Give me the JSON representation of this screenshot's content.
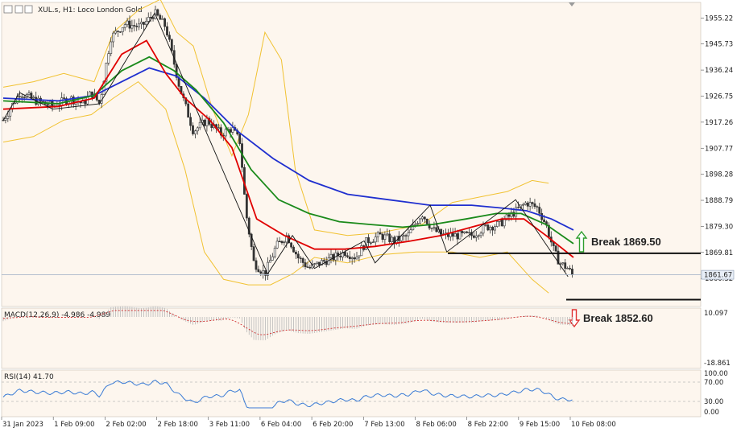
{
  "header": {
    "symbol": "XUL.s",
    "timeframe": "H1",
    "instrument": "Loco London Gold",
    "title": "XUL.s, H1:  Loco London Gold"
  },
  "colors": {
    "background": "#fdf6ee",
    "candle": "#333333",
    "bollinger": "#f1c232",
    "ma_fast": "#e00000",
    "ma_mid": "#1a8a1a",
    "ma_slow": "#1f2fcf",
    "zigzag": "#111111",
    "macd_hist": "#b8b8b8",
    "macd_signal": "#d03030",
    "rsi": "#3a7bd5",
    "arrow_up": "#2e9e2e",
    "arrow_down": "#e03030"
  },
  "price_axis": {
    "ticks": [
      "1955.22",
      "1945.73",
      "1936.24",
      "1926.75",
      "1917.26",
      "1907.77",
      "1898.28",
      "1888.79",
      "1879.30",
      "1869.81",
      "1860.32"
    ],
    "current_price": "1861.67"
  },
  "time_axis": {
    "labels": [
      "31 Jan 2023",
      "1 Feb 09:00",
      "2 Feb 02:00",
      "2 Feb 18:00",
      "3 Feb 11:00",
      "6 Feb 04:00",
      "6 Feb 20:00",
      "7 Feb 13:00",
      "8 Feb 06:00",
      "8 Feb 22:00",
      "9 Feb 15:00",
      "10 Feb 08:00"
    ]
  },
  "annotations": {
    "break_up": "Break 1869.50",
    "break_down": "Break 1852.60"
  },
  "macd": {
    "label": "MACD(12,26,9) -4.986 -4.989",
    "scale_top": "10.097",
    "scale_bottom": "-18.861"
  },
  "rsi": {
    "label": "RSI(14) 41.70",
    "levels": [
      "100.00",
      "70.00",
      "30.00",
      "0.00"
    ]
  },
  "chart_data": {
    "type": "candlestick",
    "symbol": "XUL.s",
    "timeframe": "H1",
    "instrument": "Loco London Gold",
    "ylim": [
      1851,
      1960
    ],
    "price_path": [
      [
        0,
        1918
      ],
      [
        12,
        1928
      ],
      [
        24,
        1925
      ],
      [
        36,
        1923
      ],
      [
        48,
        1926
      ],
      [
        58,
        1924
      ],
      [
        64,
        1928
      ],
      [
        70,
        1924
      ],
      [
        78,
        1948
      ],
      [
        88,
        1953
      ],
      [
        100,
        1952
      ],
      [
        110,
        1957
      ],
      [
        118,
        1952
      ],
      [
        128,
        1930
      ],
      [
        138,
        1914
      ],
      [
        148,
        1918
      ],
      [
        158,
        1913
      ],
      [
        166,
        1915
      ],
      [
        172,
        1910
      ],
      [
        176,
        1885
      ],
      [
        182,
        1866
      ],
      [
        190,
        1862
      ],
      [
        198,
        1872
      ],
      [
        206,
        1876
      ],
      [
        214,
        1868
      ],
      [
        222,
        1864
      ],
      [
        230,
        1866
      ],
      [
        240,
        1868
      ],
      [
        248,
        1870
      ],
      [
        256,
        1868
      ],
      [
        264,
        1874
      ],
      [
        274,
        1876
      ],
      [
        284,
        1874
      ],
      [
        294,
        1876
      ],
      [
        304,
        1884
      ],
      [
        312,
        1878
      ],
      [
        320,
        1876
      ],
      [
        330,
        1876
      ],
      [
        340,
        1876
      ],
      [
        350,
        1879
      ],
      [
        360,
        1880
      ],
      [
        370,
        1884
      ],
      [
        380,
        1888
      ],
      [
        388,
        1886
      ],
      [
        394,
        1880
      ],
      [
        400,
        1870
      ],
      [
        404,
        1866
      ],
      [
        410,
        1864
      ],
      [
        414,
        1861
      ]
    ],
    "x_domain": [
      0,
      414
    ],
    "series": [
      {
        "name": "zigzag",
        "values": [
          [
            0,
            1918
          ],
          [
            12,
            1928
          ],
          [
            36,
            1922
          ],
          [
            70,
            1924
          ],
          [
            110,
            1957
          ],
          [
            192,
            1862
          ],
          [
            210,
            1876
          ],
          [
            226,
            1864
          ],
          [
            262,
            1874
          ],
          [
            270,
            1866
          ],
          [
            310,
            1887
          ],
          [
            322,
            1870
          ],
          [
            372,
            1889
          ],
          [
            410,
            1861
          ]
        ]
      },
      {
        "name": "ma_fast",
        "values": [
          [
            0,
            1922
          ],
          [
            40,
            1923
          ],
          [
            66,
            1926
          ],
          [
            86,
            1942
          ],
          [
            104,
            1947
          ],
          [
            118,
            1935
          ],
          [
            132,
            1926
          ],
          [
            150,
            1918
          ],
          [
            166,
            1908
          ],
          [
            184,
            1882
          ],
          [
            204,
            1876
          ],
          [
            226,
            1871
          ],
          [
            248,
            1871
          ],
          [
            270,
            1872
          ],
          [
            296,
            1874
          ],
          [
            318,
            1876
          ],
          [
            340,
            1879
          ],
          [
            362,
            1882
          ],
          [
            378,
            1882
          ],
          [
            394,
            1876
          ],
          [
            414,
            1868
          ]
        ]
      },
      {
        "name": "ma_mid",
        "values": [
          [
            0,
            1925
          ],
          [
            40,
            1924
          ],
          [
            66,
            1927
          ],
          [
            86,
            1936
          ],
          [
            106,
            1941
          ],
          [
            124,
            1936
          ],
          [
            140,
            1929
          ],
          [
            160,
            1917
          ],
          [
            180,
            1900
          ],
          [
            200,
            1889
          ],
          [
            222,
            1884
          ],
          [
            244,
            1881
          ],
          [
            266,
            1880
          ],
          [
            290,
            1879
          ],
          [
            312,
            1880
          ],
          [
            336,
            1882
          ],
          [
            358,
            1884
          ],
          [
            376,
            1884
          ],
          [
            394,
            1880
          ],
          [
            414,
            1873
          ]
        ]
      },
      {
        "name": "ma_slow",
        "values": [
          [
            0,
            1926
          ],
          [
            40,
            1925
          ],
          [
            66,
            1927
          ],
          [
            86,
            1932
          ],
          [
            106,
            1937
          ],
          [
            126,
            1934
          ],
          [
            146,
            1926
          ],
          [
            170,
            1914
          ],
          [
            196,
            1904
          ],
          [
            222,
            1896
          ],
          [
            250,
            1891
          ],
          [
            280,
            1889
          ],
          [
            310,
            1887
          ],
          [
            340,
            1887
          ],
          [
            362,
            1886
          ],
          [
            380,
            1885
          ],
          [
            398,
            1882
          ],
          [
            414,
            1878
          ]
        ]
      },
      {
        "name": "bollinger_upper",
        "values": [
          [
            0,
            1930
          ],
          [
            22,
            1932
          ],
          [
            44,
            1935
          ],
          [
            66,
            1932
          ],
          [
            80,
            1950
          ],
          [
            98,
            1958
          ],
          [
            114,
            1962
          ],
          [
            126,
            1950
          ],
          [
            138,
            1945
          ],
          [
            152,
            1922
          ],
          [
            166,
            1905
          ],
          [
            178,
            1920
          ],
          [
            190,
            1950
          ],
          [
            202,
            1940
          ],
          [
            212,
            1900
          ],
          [
            226,
            1878
          ],
          [
            250,
            1876
          ],
          [
            274,
            1877
          ],
          [
            304,
            1880
          ],
          [
            326,
            1888
          ],
          [
            346,
            1890
          ],
          [
            366,
            1892
          ],
          [
            384,
            1896
          ],
          [
            396,
            1895
          ]
        ]
      },
      {
        "name": "bollinger_lower",
        "values": [
          [
            0,
            1910
          ],
          [
            22,
            1912
          ],
          [
            44,
            1918
          ],
          [
            64,
            1920
          ],
          [
            80,
            1926
          ],
          [
            98,
            1932
          ],
          [
            118,
            1922
          ],
          [
            132,
            1900
          ],
          [
            146,
            1870
          ],
          [
            160,
            1860
          ],
          [
            178,
            1858
          ],
          [
            194,
            1858
          ],
          [
            210,
            1862
          ],
          [
            226,
            1868
          ],
          [
            250,
            1866
          ],
          [
            274,
            1869
          ],
          [
            300,
            1870
          ],
          [
            326,
            1870
          ],
          [
            346,
            1868
          ],
          [
            366,
            1870
          ],
          [
            384,
            1860
          ],
          [
            396,
            1855
          ]
        ]
      }
    ],
    "horizontal_lines": [
      {
        "label": "Break 1869.50",
        "value": 1869.5
      },
      {
        "label": "Break 1852.60",
        "value": 1852.6
      }
    ],
    "macd": {
      "name": "MACD(12,26,9)",
      "main": -4.986,
      "signal": -4.989,
      "ylim": [
        -18.861,
        10.097
      ]
    },
    "rsi": {
      "name": "RSI(14)",
      "value": 41.7,
      "levels": [
        70,
        30
      ],
      "ylim": [
        0,
        100
      ]
    }
  }
}
